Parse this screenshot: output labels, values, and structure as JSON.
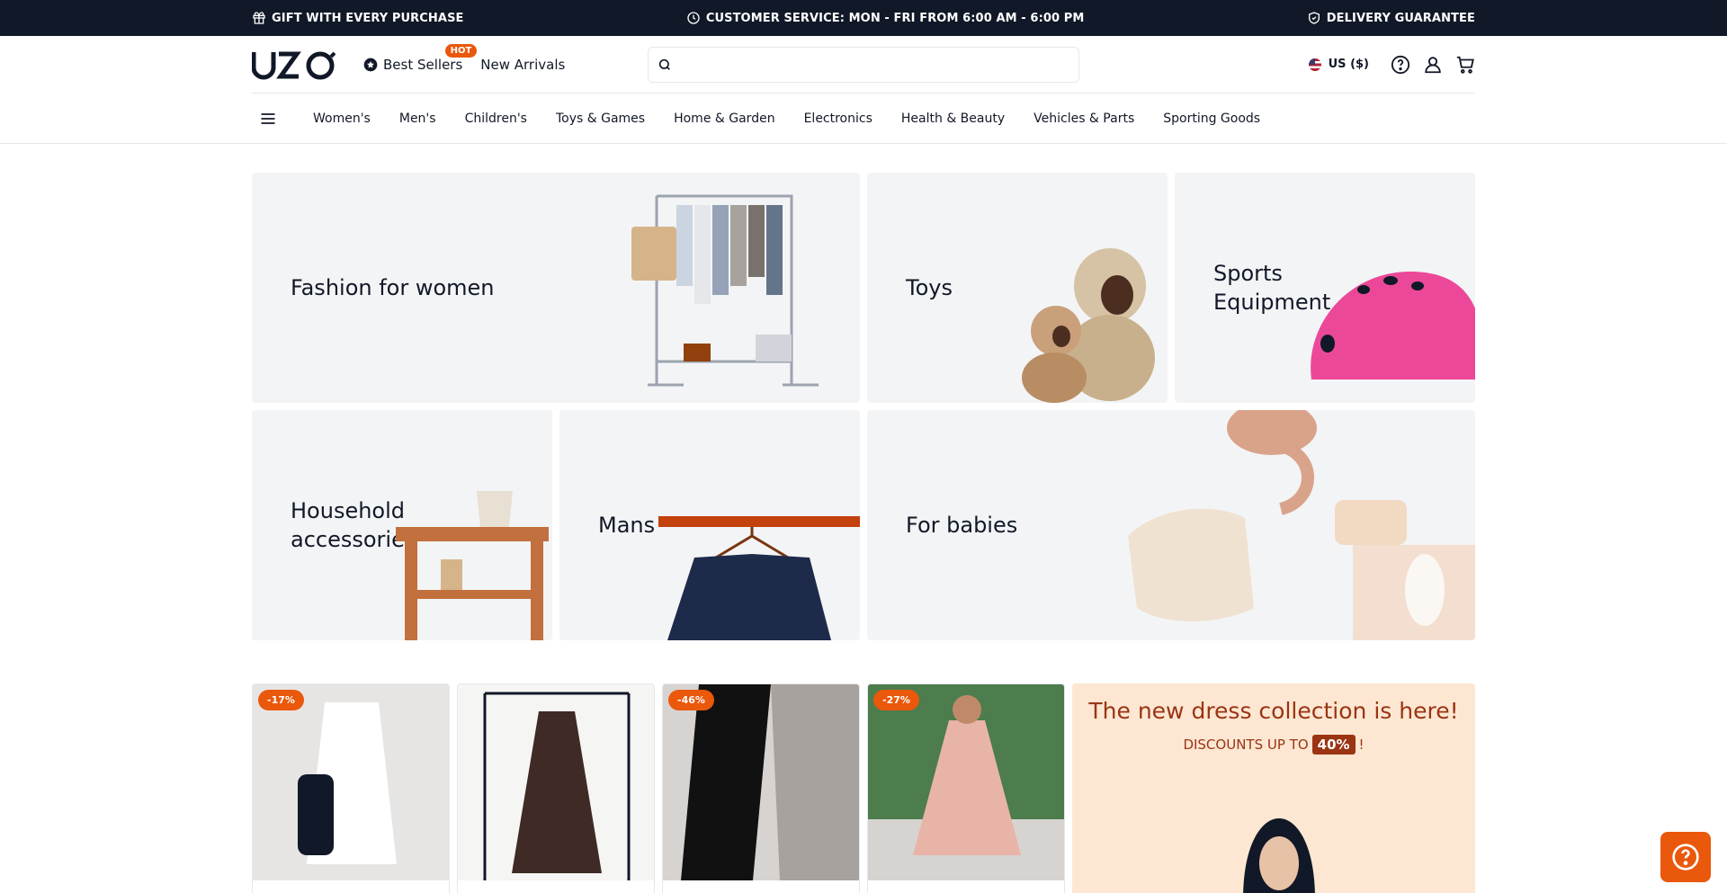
{
  "topbar": {
    "gift": "GIFT WITH EVERY PURCHASE",
    "service": "CUSTOMER SERVICE: MON - FRI FROM 6:00 AM - 6:00 PM",
    "delivery": "DELIVERY GUARANTEE"
  },
  "header": {
    "logo": "UZO",
    "best_sellers": "Best Sellers",
    "hot_badge": "HOT",
    "new_arrivals": "New Arrivals",
    "search_placeholder": "",
    "currency": "US ($)"
  },
  "categories_nav": [
    "Women's",
    "Men's",
    "Children's",
    "Toys & Games",
    "Home & Garden",
    "Electronics",
    "Health & Beauty",
    "Vehicles & Parts",
    "Sporting Goods"
  ],
  "tiles": {
    "fashion": "Fashion for women",
    "toys": "Toys",
    "sports": "Sports Equipment",
    "household": "Household accessories",
    "mans": "Mans",
    "babies": "For babies"
  },
  "products": [
    {
      "discount": "-17%"
    },
    {
      "discount": ""
    },
    {
      "discount": "-46%"
    },
    {
      "discount": "-27%"
    }
  ],
  "promo": {
    "title": "The new dress collection is here!",
    "subtitle": "DISCOUNTS UP TO",
    "percent": "40%",
    "suffix": "!"
  },
  "colors": {
    "topbar_bg": "#111827",
    "accent": "#ea580c",
    "tile_bg": "#f3f4f6",
    "promo_bg": "#fde7d3"
  }
}
